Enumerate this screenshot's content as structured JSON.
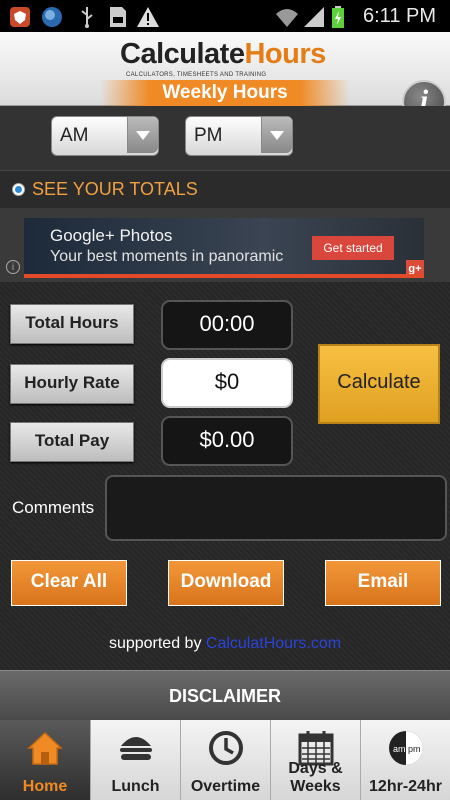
{
  "status_bar": {
    "time": "6:11 PM"
  },
  "header": {
    "logo_part1": "Calculate",
    "logo_part2": "Hours",
    "tagline": "CALCULATORS, TIMESHEETS AND TRAINING",
    "banner": "Weekly Hours",
    "info_label": "i"
  },
  "ampm": {
    "left_value": "AM",
    "right_value": "PM"
  },
  "totals": {
    "label": "SEE YOUR TOTALS"
  },
  "ad": {
    "title": "Google+ Photos",
    "subtitle": "Your best moments in panoramic",
    "button": "Get started",
    "badge": "g+",
    "info": "i"
  },
  "calculator": {
    "total_hours_label": "Total Hours",
    "total_hours_value": "00:00",
    "hourly_rate_label": "Hourly Rate",
    "hourly_rate_value": "$0",
    "total_pay_label": "Total Pay",
    "total_pay_value": "$0.00",
    "calculate_label": "Calculate",
    "comments_label": "Comments",
    "comments_value": "",
    "clear_label": "Clear All",
    "download_label": "Download",
    "email_label": "Email"
  },
  "footer": {
    "supported_prefix": "supported by ",
    "supported_link": "CalculatHours.com",
    "disclaimer": "DISCLAIMER"
  },
  "tabs": [
    {
      "label": "Home",
      "icon": "home-icon"
    },
    {
      "label": "Lunch",
      "icon": "burger-icon"
    },
    {
      "label": "Overtime",
      "icon": "clock-icon"
    },
    {
      "label": "Days & Weeks",
      "icon": "calendar-icon"
    },
    {
      "label": "12hr-24hr",
      "icon": "ampm-icon"
    }
  ],
  "colors": {
    "accent": "#f08a24",
    "gold": "#f0b43a",
    "link": "#2a44d8"
  }
}
